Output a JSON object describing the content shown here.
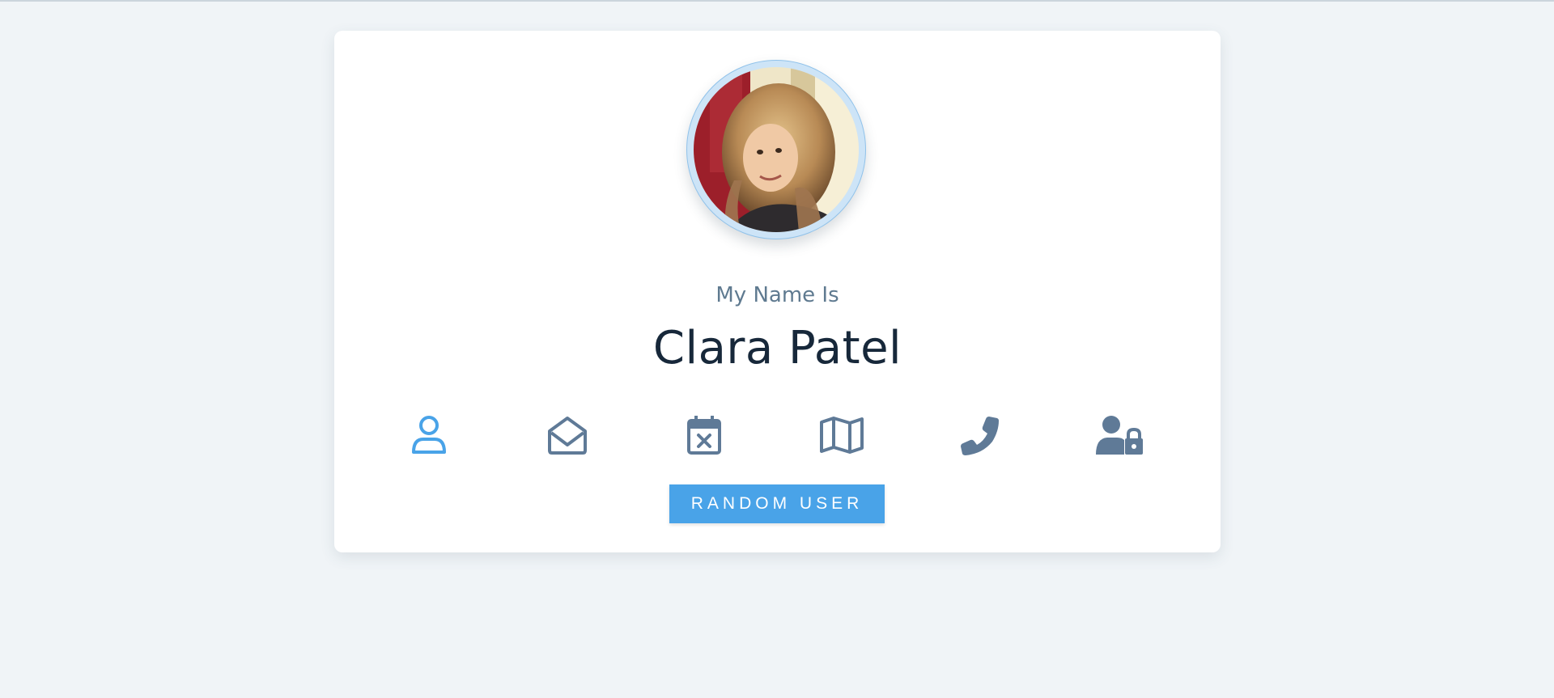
{
  "profile": {
    "subtitle": "My Name Is",
    "name": "Clara Patel",
    "avatar_alt": "user-portrait"
  },
  "icons": [
    {
      "name": "user-icon",
      "active": true
    },
    {
      "name": "envelope-open-icon",
      "active": false
    },
    {
      "name": "calendar-x-icon",
      "active": false
    },
    {
      "name": "map-icon",
      "active": false
    },
    {
      "name": "phone-icon",
      "active": false
    },
    {
      "name": "user-lock-icon",
      "active": false
    }
  ],
  "button": {
    "label": "RANDOM USER"
  },
  "colors": {
    "page_bg": "#f0f4f7",
    "card_bg": "#ffffff",
    "accent": "#49a3e8",
    "icon_inactive": "#5f7a97",
    "name_text": "#17283a",
    "subtitle_text": "#5f7a90"
  }
}
